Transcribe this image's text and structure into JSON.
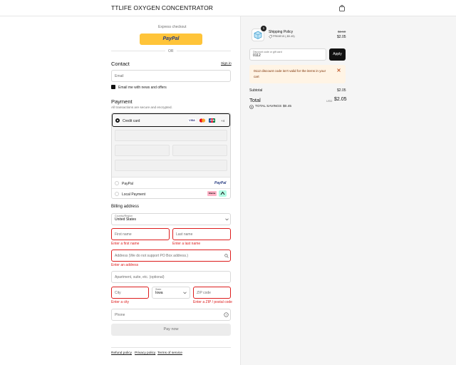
{
  "header": {
    "title": "TTLIFE OXYGEN CONCENTRATOR"
  },
  "express": {
    "label": "Express checkout",
    "paypal_label": "PayPal",
    "or_label": "OR"
  },
  "contact": {
    "heading": "Contact",
    "sign_in": "Sign in",
    "email_placeholder": "Email",
    "news_label": "Email me with news and offers"
  },
  "payment": {
    "heading": "Payment",
    "subtext": "All transactions are secure and encrypted.",
    "credit_card_label": "Credit card",
    "card_brands": [
      "VISA",
      "MC",
      "JCB"
    ],
    "more_cards": "+4",
    "paypal_label": "PayPal",
    "paypal_logo": "PayPal",
    "local_label": "Local Payment",
    "local_logo": "Klarna"
  },
  "billing": {
    "heading": "Billing address",
    "country_label": "Country/Region",
    "country_value": "United States",
    "first_name_placeholder": "First name",
    "last_name_placeholder": "Last name",
    "first_name_error": "Enter a first name",
    "last_name_error": "Enter a last name",
    "address_placeholder": "Address (We do not support PO Box address.)",
    "address_error": "Enter an address",
    "apartment_placeholder": "Apartment, suite, etc. (optional)",
    "city_placeholder": "City",
    "city_error": "Enter a city",
    "state_label": "State",
    "state_value": "Iowa",
    "zip_placeholder": "ZIP code",
    "zip_error": "Enter a ZIP / postal code",
    "phone_placeholder": "Phone"
  },
  "pay_button": "Pay now",
  "footer_links": [
    "Refund policy",
    "Privacy policy",
    "Terms of service"
  ],
  "summary": {
    "item": {
      "qty": "1",
      "name": "Shipping Policy",
      "code": "PRIME15 (-$0.45)",
      "old_price": "$2.50",
      "price": "$2.05"
    },
    "discount_label": "Discount code or gift card",
    "discount_value": "0112",
    "apply_label": "Apply",
    "alert_text": "0112 discount code isn't valid for the items in your cart",
    "subtotal_label": "Subtotal",
    "subtotal_value": "$2.05",
    "total_label": "Total",
    "currency": "USD",
    "total_value": "$2.05",
    "savings_label": "TOTAL SAVINGS",
    "savings_value": "$0.45"
  },
  "colors": {
    "error": "#dd1d1d",
    "paypal_yellow": "#ffc439",
    "alert_bg": "#fff4e5",
    "apply_bg": "#111111"
  }
}
